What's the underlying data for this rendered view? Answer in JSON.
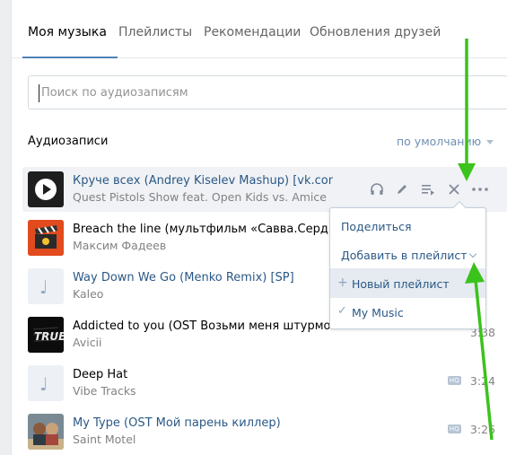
{
  "tabs": [
    {
      "label": "Моя музыка",
      "active": true
    },
    {
      "label": "Плейлисты",
      "active": false
    },
    {
      "label": "Рекомендации",
      "active": false
    },
    {
      "label": "Обновления друзей",
      "active": false
    }
  ],
  "search": {
    "placeholder": "Поиск по аудиозаписям",
    "value": ""
  },
  "section": {
    "title": "Аудиозаписи",
    "sort_label": "по умолчанию"
  },
  "tracks": [
    {
      "title": "Круче всех (Andrey Kiselev Mashup) [vk.com/...",
      "artist": "Quest Pistols Show feat. Open Kids vs. Amice",
      "duration": "",
      "hq": false,
      "playing": true
    },
    {
      "title": "Breach the line (мультфильм «Савва.Сердце вои",
      "artist": "Максим Фадеев",
      "duration": "",
      "hq": false
    },
    {
      "title": "Way Down We Go (Menko Remix) [SP]",
      "artist": "Kaleo",
      "duration": "",
      "hq": false
    },
    {
      "title": "Addicted to you (OST Возьми меня штурмом)",
      "artist": "Avicii",
      "duration": "3:38",
      "hq": false
    },
    {
      "title": "Deep Hat",
      "artist": "Vibe Tracks",
      "duration": "3:24",
      "hq": true,
      "hq_label": "HQ"
    },
    {
      "title": "My Type (OST Мой парень киллер)",
      "artist": "Saint Motel",
      "duration": "3:26",
      "hq": true,
      "hq_label": "HQ"
    }
  ],
  "track_actions": [
    "headphones-icon",
    "edit-icon",
    "add-to-playlist-icon",
    "delete-icon",
    "more-icon"
  ],
  "menu": {
    "share": "Поделиться",
    "add_to_playlist": "Добавить в плейлист",
    "new_playlist": "Новый плейлист",
    "my_music": "My Music"
  },
  "colors": {
    "accent": "#5181b8",
    "link": "#2a5885",
    "annotation_arrow": "#3cc21c"
  }
}
